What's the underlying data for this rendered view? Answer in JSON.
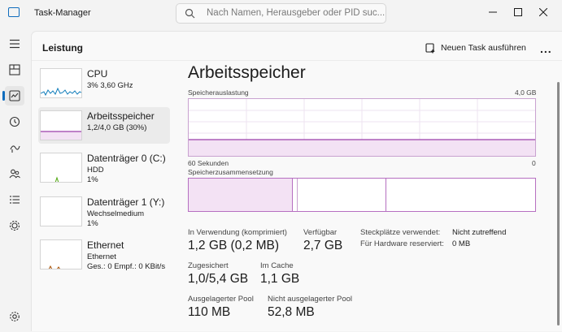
{
  "window": {
    "title": "Task-Manager",
    "search_placeholder": "Nach Namen, Herausgeber oder PID suc..."
  },
  "header": {
    "page_title": "Leistung",
    "new_task_label": "Neuen Task ausführen",
    "more_label": "..."
  },
  "nav": {
    "icons": [
      "hamburger-menu-icon",
      "processes-icon",
      "performance-icon",
      "app-history-icon",
      "startup-apps-icon",
      "users-icon",
      "details-icon",
      "services-icon",
      "settings-icon"
    ]
  },
  "sidebar": {
    "items": [
      {
        "name": "CPU",
        "sub1": "3% 3,60 GHz",
        "sub2": ""
      },
      {
        "name": "Arbeitsspeicher",
        "sub1": "1,2/4,0 GB (30%)",
        "sub2": ""
      },
      {
        "name": "Datenträger 0 (C:)",
        "sub1": "HDD",
        "sub2": "1%"
      },
      {
        "name": "Datenträger 1 (Y:)",
        "sub1": "Wechselmedium",
        "sub2": "1%"
      },
      {
        "name": "Ethernet",
        "sub1": "Ethernet",
        "sub2": "Ges.: 0 Empf.: 0 KBit/s"
      }
    ]
  },
  "detail": {
    "title": "Arbeitsspeicher",
    "usage_label": "Speicherauslastung",
    "usage_max": "4,0 GB",
    "time_label": "60 Sekunden",
    "time_zero": "0",
    "composition_label": "Speicherzusammensetzung",
    "usage_fraction": 0.3,
    "stats": {
      "in_use_label": "In Verwendung (komprimiert)",
      "in_use_value": "1,2 GB (0,2 MB)",
      "available_label": "Verfügbar",
      "available_value": "2,7 GB",
      "committed_label": "Zugesichert",
      "committed_value": "1,0/5,4 GB",
      "cached_label": "Im Cache",
      "cached_value": "1,1 GB",
      "paged_label": "Ausgelagerter Pool",
      "paged_value": "110 MB",
      "nonpaged_label": "Nicht ausgelagerter Pool",
      "nonpaged_value": "52,8 MB"
    },
    "kv": {
      "slots_label": "Steckplätze verwendet:",
      "slots_value": "Nicht zutreffend",
      "reserved_label": "Für Hardware reserviert:",
      "reserved_value": "0 MB"
    }
  },
  "colors": {
    "memory_accent": "#9b3faa",
    "cpu_accent": "#117dbb",
    "disk_accent": "#4da60c",
    "ethernet_accent": "#a74f01"
  }
}
